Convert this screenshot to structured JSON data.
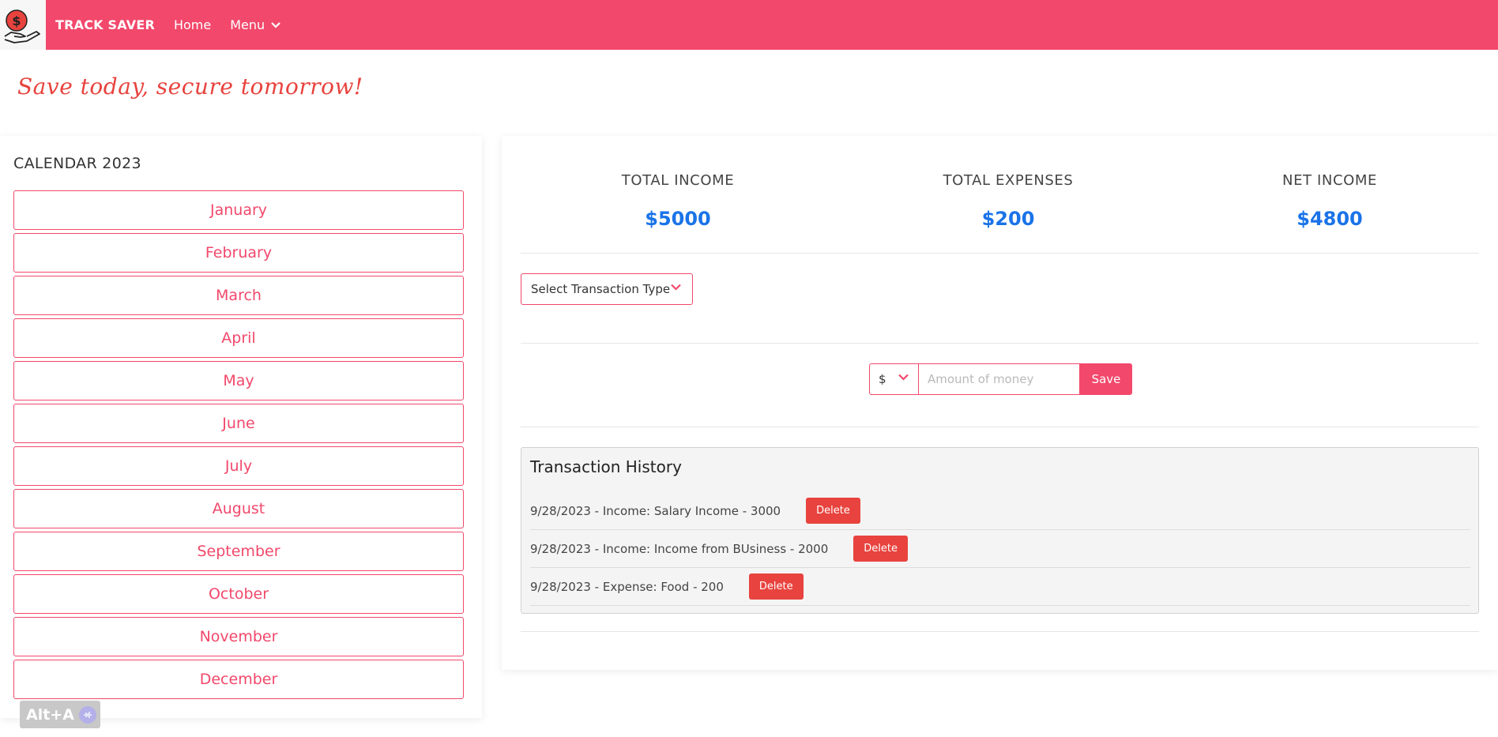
{
  "navbar": {
    "brand": "TRACK SAVER",
    "home_label": "Home",
    "menu_label": "Menu",
    "logo_icon": "hand-coin-icon"
  },
  "tagline": "Save today, secure tomorrow!",
  "calendar": {
    "title": "CALENDAR 2023",
    "months": [
      "January",
      "February",
      "March",
      "April",
      "May",
      "June",
      "July",
      "August",
      "September",
      "October",
      "November",
      "December"
    ]
  },
  "summary": {
    "income_label": "TOTAL INCOME",
    "income_value": "$5000",
    "expenses_label": "TOTAL EXPENSES",
    "expenses_value": "$200",
    "net_label": "NET INCOME",
    "net_value": "$4800"
  },
  "form": {
    "transaction_type_placeholder": "Select Transaction Type",
    "currency": "$",
    "amount_placeholder": "Amount of money",
    "save_label": "Save"
  },
  "history": {
    "title": "Transaction History",
    "delete_label": "Delete",
    "items": [
      "9/28/2023 - Income: Salary Income - 3000",
      "9/28/2023 - Income: Income from BUsiness - 2000",
      "9/28/2023 - Expense: Food - 200"
    ]
  },
  "shortcut_badge": "Alt+A",
  "colors": {
    "brand": "#f2486b",
    "accent_blue": "#1a73e8",
    "danger": "#e8433e"
  }
}
